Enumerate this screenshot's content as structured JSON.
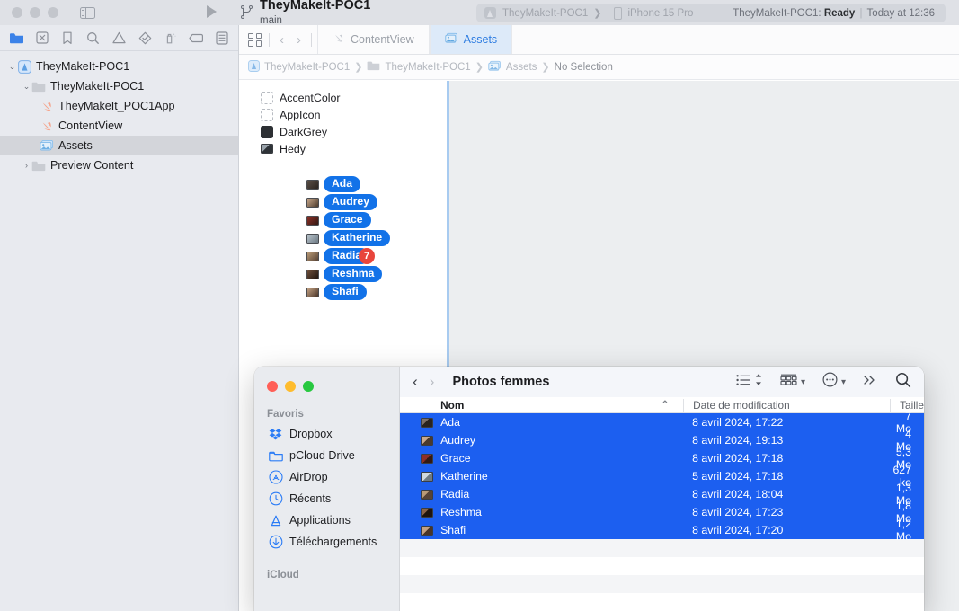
{
  "xcode": {
    "titlebar": {
      "scheme_name": "TheyMakeIt-POC1",
      "branch": "main",
      "run_icon": "run-play-icon",
      "sidebar_toggle_icon": "sidebar-toggle-icon"
    },
    "status_bar": {
      "scheme": "TheyMakeIt-POC1",
      "separator": "❯",
      "destination": "iPhone 15 Pro",
      "project": "TheyMakeIt-POC1:",
      "state": "Ready",
      "divider": "|",
      "time": "Today at 12:36"
    },
    "navigator_filters": [
      {
        "name": "project-navigator-icon",
        "active": true
      },
      {
        "name": "source-control-navigator-icon",
        "active": false
      },
      {
        "name": "bookmark-navigator-icon",
        "active": false
      },
      {
        "name": "find-navigator-icon",
        "active": false
      },
      {
        "name": "issue-navigator-icon",
        "active": false
      },
      {
        "name": "test-navigator-icon",
        "active": false
      },
      {
        "name": "debug-navigator-icon",
        "active": false
      },
      {
        "name": "breakpoint-navigator-icon",
        "active": false
      },
      {
        "name": "report-navigator-icon",
        "active": false
      }
    ],
    "navigator_tree": [
      {
        "label": "TheyMakeIt-POC1",
        "indent": 0,
        "twisty": "⌄",
        "icon": "xcode-project-icon",
        "selected": false
      },
      {
        "label": "TheyMakeIt-POC1",
        "indent": 1,
        "twisty": "⌄",
        "icon": "folder-icon",
        "selected": false
      },
      {
        "label": "TheyMakeIt_POC1App",
        "indent": 2,
        "twisty": "",
        "icon": "swift-file-icon",
        "selected": false
      },
      {
        "label": "ContentView",
        "indent": 2,
        "twisty": "",
        "icon": "swift-file-icon",
        "selected": false
      },
      {
        "label": "Assets",
        "indent": 2,
        "twisty": "",
        "icon": "assets-catalog-icon",
        "selected": true
      },
      {
        "label": "Preview Content",
        "indent": 1,
        "twisty": "›",
        "icon": "folder-icon",
        "selected": false
      }
    ],
    "tabs": [
      {
        "label": "ContentView",
        "icon": "swift-file-icon",
        "active": false
      },
      {
        "label": "Assets",
        "icon": "assets-catalog-icon",
        "active": true
      }
    ],
    "breadcrumb": [
      {
        "label": "TheyMakeIt-POC1",
        "icon": "xcode-project-icon"
      },
      {
        "label": "TheyMakeIt-POC1",
        "icon": "folder-icon"
      },
      {
        "label": "Assets",
        "icon": "assets-catalog-icon"
      },
      {
        "label": "No Selection",
        "icon": ""
      }
    ],
    "breadcrumb_separator": "❯",
    "assets": [
      {
        "label": "AccentColor",
        "icon": "color-placeholder-icon"
      },
      {
        "label": "AppIcon",
        "icon": "appicon-placeholder-icon"
      },
      {
        "label": "DarkGrey",
        "icon": "color-swatch-icon"
      },
      {
        "label": "Hedy",
        "icon": "image-thumbnail-icon"
      }
    ],
    "drag_ghost": {
      "badge_count": "7",
      "items": [
        {
          "label": "Ada",
          "c1": "#5a4e46",
          "c2": "#2a2420"
        },
        {
          "label": "Audrey",
          "c1": "#c9a98d",
          "c2": "#4b3a2c"
        },
        {
          "label": "Grace",
          "c1": "#8e2f26",
          "c2": "#321a14"
        },
        {
          "label": "Katherine",
          "c1": "#b9c4cc",
          "c2": "#6d7a84"
        },
        {
          "label": "Radia",
          "c1": "#b99a76",
          "c2": "#574335"
        },
        {
          "label": "Reshma",
          "c1": "#6e4f3a",
          "c2": "#20150f"
        },
        {
          "label": "Shafi",
          "c1": "#c3a183",
          "c2": "#4a3528"
        }
      ]
    }
  },
  "finder": {
    "window_controls": {
      "close": "#ff5f57",
      "minimize": "#febc2e",
      "zoom": "#28c840"
    },
    "title": "Photos femmes",
    "nav": {
      "back": "‹",
      "forward": "›"
    },
    "toolbar_icons": [
      "list-view-icon",
      "sort-order-icon",
      "group-by-icon",
      "more-actions-icon",
      "overflow-icon",
      "search-icon"
    ],
    "sidebar": {
      "sections": [
        {
          "title": "Favoris",
          "items": [
            {
              "label": "Dropbox",
              "icon": "dropbox-icon"
            },
            {
              "label": "pCloud Drive",
              "icon": "folder-icon"
            },
            {
              "label": "AirDrop",
              "icon": "airdrop-icon"
            },
            {
              "label": "Récents",
              "icon": "clock-icon"
            },
            {
              "label": "Applications",
              "icon": "applications-icon"
            },
            {
              "label": "Téléchargements",
              "icon": "downloads-icon"
            }
          ]
        },
        {
          "title": "iCloud",
          "items": []
        }
      ]
    },
    "columns": [
      {
        "label": "Nom",
        "sorted": true,
        "sort_arrow": "⌃"
      },
      {
        "label": "Date de modification",
        "sorted": false
      },
      {
        "label": "Taille",
        "sorted": false
      }
    ],
    "files": [
      {
        "name": "Ada",
        "date": "8 avril 2024, 17:22",
        "size": "7 Mo",
        "selected": true,
        "c1": "#5a4e46",
        "c2": "#2a2420"
      },
      {
        "name": "Audrey",
        "date": "8 avril 2024, 19:13",
        "size": "4 Mo",
        "selected": true,
        "c1": "#c9a98d",
        "c2": "#4b3a2c"
      },
      {
        "name": "Grace",
        "date": "8 avril 2024, 17:18",
        "size": "5,3 Mo",
        "selected": true,
        "c1": "#8e2f26",
        "c2": "#321a14"
      },
      {
        "name": "Katherine",
        "date": "5 avril 2024, 17:18",
        "size": "627 ko",
        "selected": true,
        "c1": "#b9c4cc",
        "c2": "#6d7a84"
      },
      {
        "name": "Radia",
        "date": "8 avril 2024, 18:04",
        "size": "1,3 Mo",
        "selected": true,
        "c1": "#b99a76",
        "c2": "#574335"
      },
      {
        "name": "Reshma",
        "date": "8 avril 2024, 17:23",
        "size": "1,8 Mo",
        "selected": true,
        "c1": "#6e4f3a",
        "c2": "#20150f"
      },
      {
        "name": "Shafi",
        "date": "8 avril 2024, 17:20",
        "size": "1,2 Mo",
        "selected": true,
        "c1": "#c3a183",
        "c2": "#4a3528"
      }
    ]
  },
  "colors": {
    "selection_blue": "#1c5ff0",
    "drag_pill_blue": "#1272e8",
    "badge_red": "#e8453c",
    "tab_active_bg": "#ddeaf9",
    "tab_active_text": "#2f7de1",
    "finder_sidebar_icon": "#2b7cf6"
  }
}
